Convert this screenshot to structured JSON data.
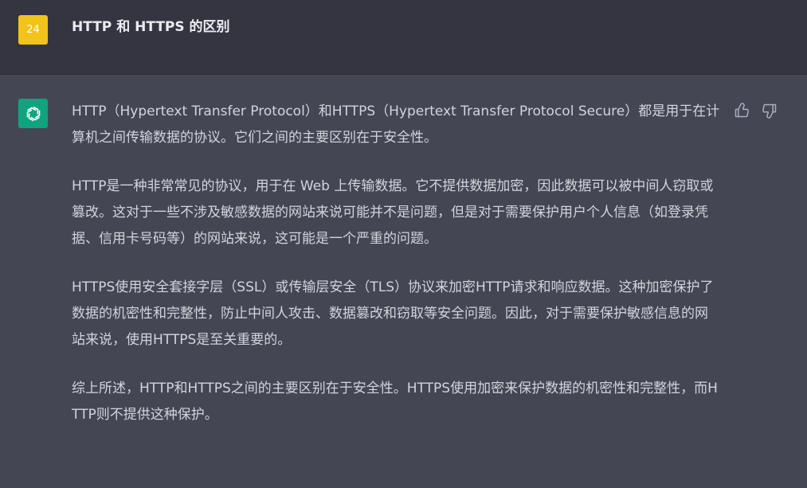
{
  "user_message": {
    "avatar_text": "24",
    "text": "HTTP 和 HTTPS 的区别"
  },
  "assistant_message": {
    "paragraphs": [
      "HTTP（Hypertext Transfer Protocol）和HTTPS（Hypertext Transfer Protocol Secure）都是用于在计算机之间传输数据的协议。它们之间的主要区别在于安全性。",
      "HTTP是一种非常常见的协议，用于在 Web 上传输数据。它不提供数据加密，因此数据可以被中间人窃取或篡改。这对于一些不涉及敏感数据的网站来说可能并不是问题，但是对于需要保护用户个人信息（如登录凭据、信用卡号码等）的网站来说，这可能是一个严重的问题。",
      "HTTPS使用安全套接字层（SSL）或传输层安全（TLS）协议来加密HTTP请求和响应数据。这种加密保护了数据的机密性和完整性，防止中间人攻击、数据篡改和窃取等安全问题。因此，对于需要保护敏感信息的网站来说，使用HTTPS是至关重要的。",
      "综上所述，HTTP和HTTPS之间的主要区别在于安全性。HTTPS使用加密来保护数据的机密性和完整性，而HTTP则不提供这种保护。"
    ]
  },
  "icons": {
    "user_avatar": "user-avatar-icon",
    "assistant_avatar": "openai-logo-icon",
    "like": "thumbs-up-icon",
    "dislike": "thumbs-down-icon"
  },
  "colors": {
    "user_avatar_bg": "#f2c318",
    "assistant_avatar_bg": "#10a37f",
    "user_row_bg": "#343541",
    "assistant_row_bg": "#444654"
  }
}
